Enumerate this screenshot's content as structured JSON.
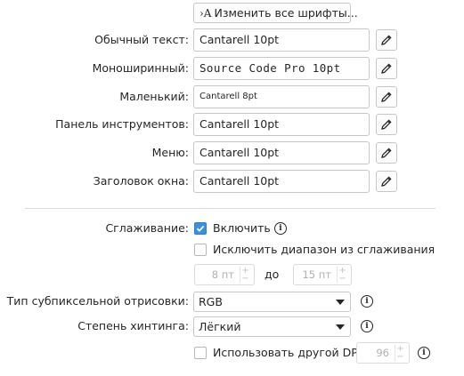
{
  "change_all_fonts": {
    "icon": "font-icon",
    "label": "Изменить все шрифты..."
  },
  "fonts": [
    {
      "label": "Обычный текст:",
      "value": "Cantarell 10pt"
    },
    {
      "label": "Моноширинный:",
      "value": "Source Code Pro 10pt"
    },
    {
      "label": "Маленький:",
      "value": "Cantarell 8pt"
    },
    {
      "label": "Панель инструментов:",
      "value": "Cantarell 10pt"
    },
    {
      "label": "Меню:",
      "value": "Cantarell 10pt"
    },
    {
      "label": "Заголовок окна:",
      "value": "Cantarell 10pt"
    }
  ],
  "antialiasing": {
    "label": "Сглаживание:",
    "enable_label": "Включить",
    "enable_checked": true,
    "exclude_label": "Исключить диапазон из сглаживания",
    "exclude_checked": false,
    "range_from": "8 пт",
    "range_to_label": "до",
    "range_to": "15 пт"
  },
  "subpixel": {
    "label": "Тип субпиксельной отрисовки:",
    "value": "RGB"
  },
  "hinting": {
    "label": "Степень хинтинга:",
    "value": "Лёгкий"
  },
  "dpi": {
    "label": "Использовать другой DPI:",
    "checked": false,
    "value": "96"
  },
  "accent_color": "#3d8fe0"
}
